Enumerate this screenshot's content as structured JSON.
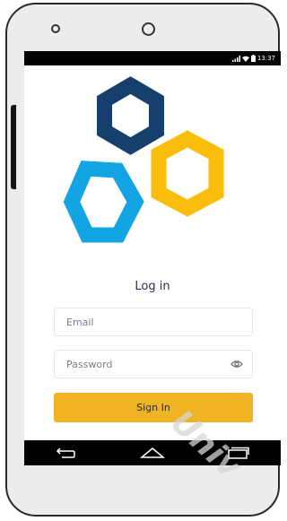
{
  "status_bar": {
    "time": "13:37",
    "icons": [
      "signal-icon",
      "wifi-icon",
      "battery-icon"
    ]
  },
  "logo": {
    "colors": {
      "top": "#163f6e",
      "right": "#fbbd0b",
      "left": "#13a4e3"
    }
  },
  "login": {
    "title": "Log in",
    "email_placeholder": "Email",
    "password_placeholder": "Password",
    "sign_in_label": "Sign In"
  },
  "nav_bar": {
    "icons": [
      "back-icon",
      "home-icon",
      "recent-apps-icon"
    ]
  },
  "watermark": {
    "text": "Univ"
  },
  "colors": {
    "accent": "#f0b323",
    "title": "#2c2c5c",
    "frame": "#ededed"
  }
}
